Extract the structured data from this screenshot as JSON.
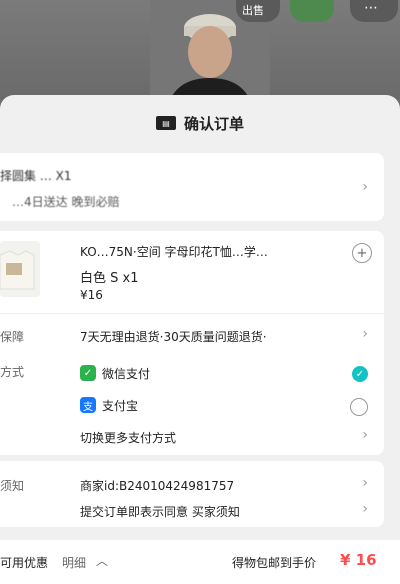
{
  "header": {
    "title": "确认订单",
    "icon": "order-icon"
  },
  "top_buttons": {
    "share_label": "出售"
  },
  "address": {
    "line1": "择圆集 …  X1",
    "line2": "…4日送达  晚到必赔"
  },
  "product": {
    "title": "KO…75N·空间 字母印花T恤…学…",
    "spec": "白色 S x1",
    "price": "¥16"
  },
  "guarantee": {
    "label": "保障",
    "text": "7天无理由退货·30天质量问题退货·"
  },
  "payment": {
    "label": "方式",
    "options": [
      {
        "name": "微信支付",
        "selected": true,
        "icon": "wechat-pay-icon",
        "color": "#2bb24c"
      },
      {
        "name": "支付宝",
        "selected": false,
        "icon": "alipay-icon",
        "color": "#1677ff"
      }
    ],
    "more": "切换更多支付方式"
  },
  "notice": {
    "label": "须知",
    "merchant": "商家id:B24010424981757",
    "agreement": "提交订单即表示同意 买家须知"
  },
  "footer": {
    "coupon_label": "可用优惠",
    "detail_label": "明细",
    "total_label": "得物包邮到手价",
    "total_value": "¥ 16"
  },
  "colors": {
    "accent": "#ff4d4f",
    "check": "#13c2c2"
  }
}
